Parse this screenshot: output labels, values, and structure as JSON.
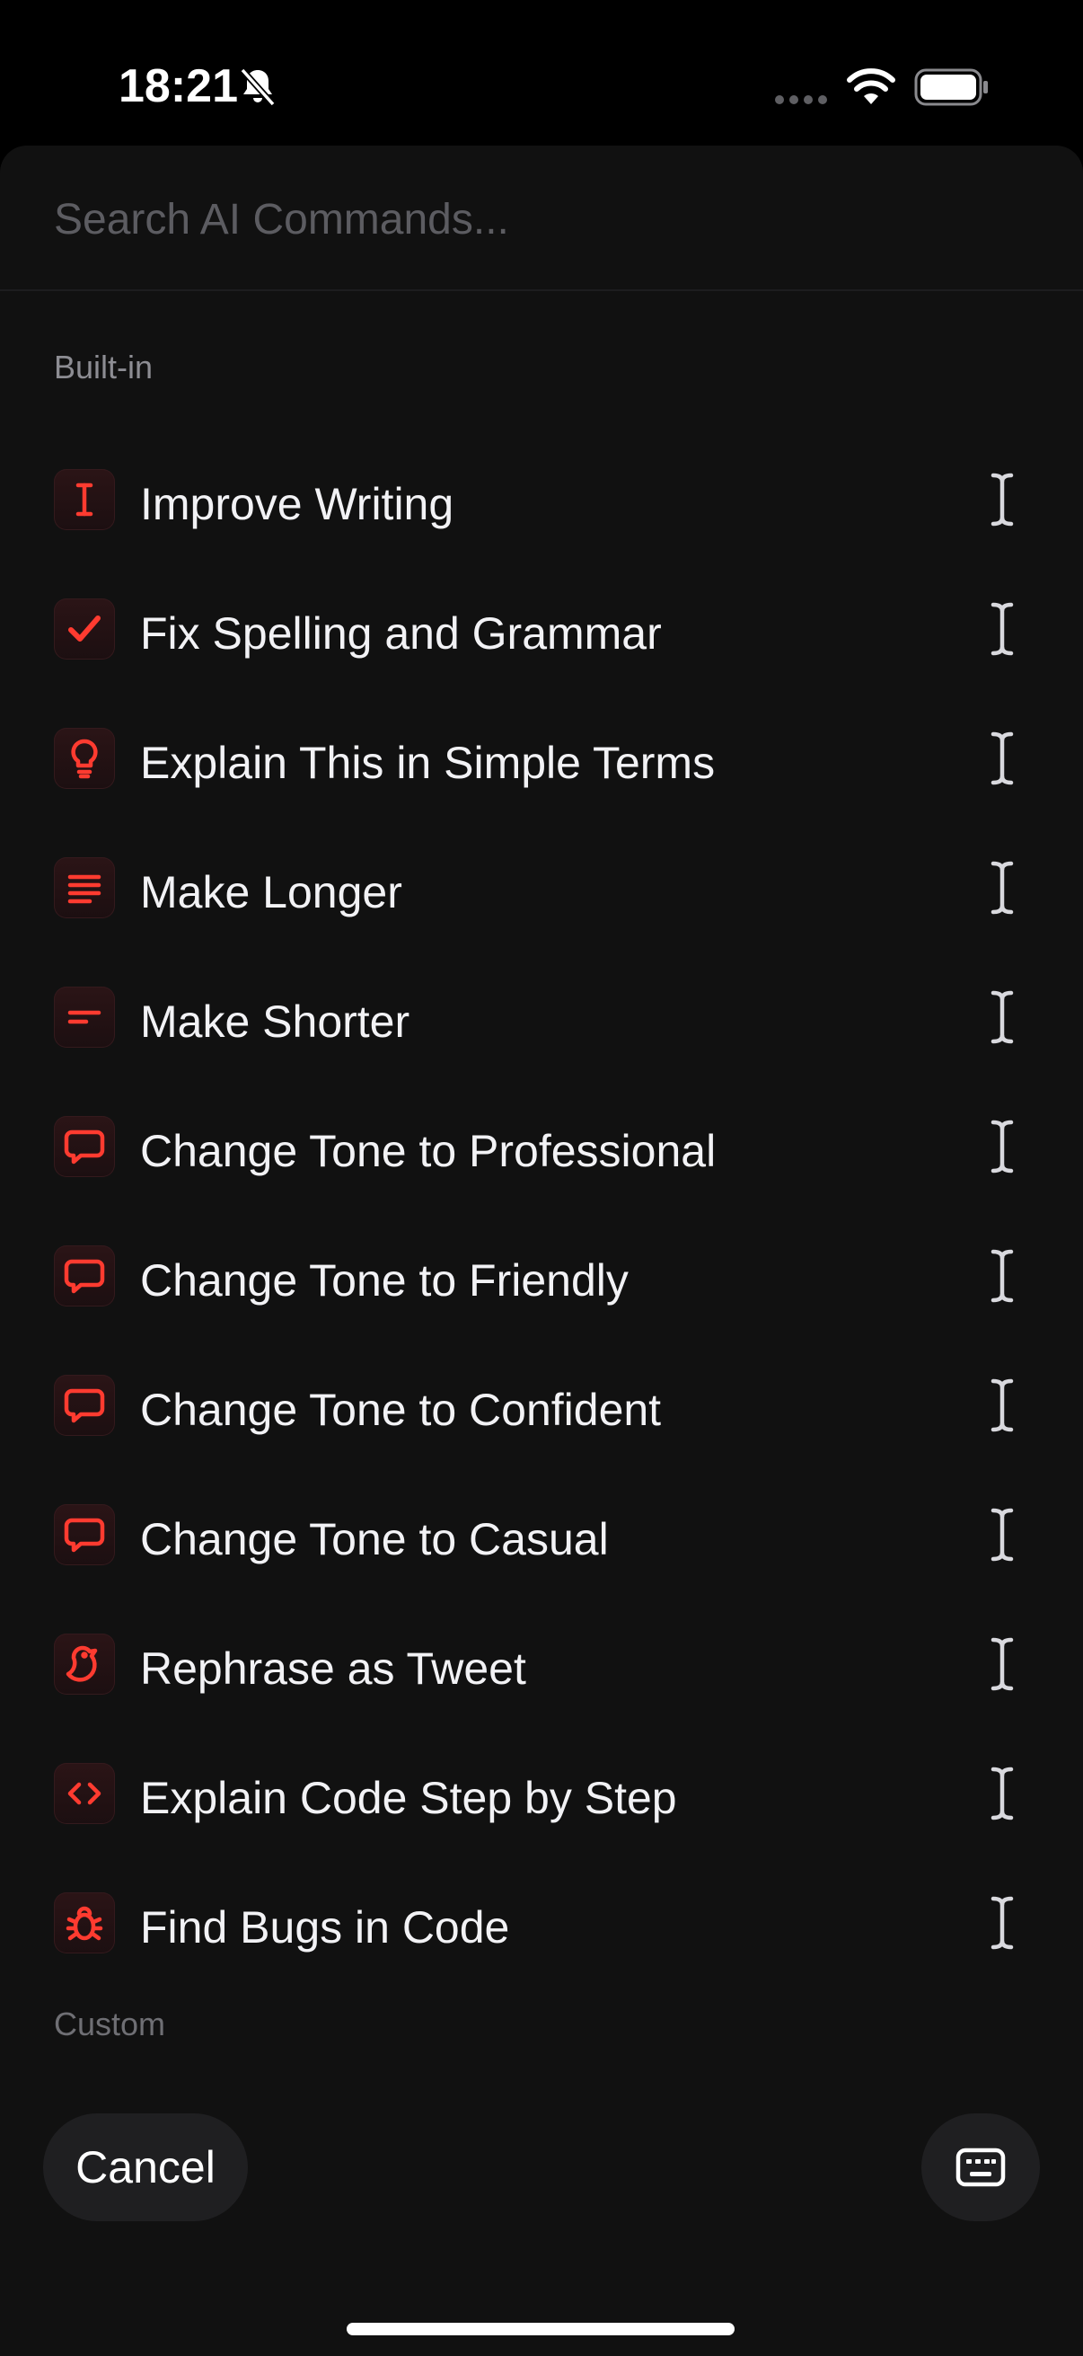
{
  "status_bar": {
    "time": "18:21",
    "icons": [
      "bell-slash-icon",
      "signal-icon",
      "wifi-icon",
      "battery-icon"
    ]
  },
  "search": {
    "placeholder": "Search AI Commands...",
    "value": ""
  },
  "sections": {
    "builtin_label": "Built-in",
    "custom_label": "Custom"
  },
  "commands": [
    {
      "label": "Improve Writing",
      "icon": "text-cursor-icon"
    },
    {
      "label": "Fix Spelling and Grammar",
      "icon": "checkmark-icon"
    },
    {
      "label": "Explain This in Simple Terms",
      "icon": "lightbulb-icon"
    },
    {
      "label": "Make Longer",
      "icon": "lines-long-icon"
    },
    {
      "label": "Make Shorter",
      "icon": "lines-short-icon"
    },
    {
      "label": "Change Tone to Professional",
      "icon": "speech-bubble-icon"
    },
    {
      "label": "Change Tone to Friendly",
      "icon": "speech-bubble-icon"
    },
    {
      "label": "Change Tone to Confident",
      "icon": "speech-bubble-icon"
    },
    {
      "label": "Change Tone to Casual",
      "icon": "speech-bubble-icon"
    },
    {
      "label": "Rephrase as Tweet",
      "icon": "bird-icon"
    },
    {
      "label": "Explain Code Step by Step",
      "icon": "code-brackets-icon"
    },
    {
      "label": "Find Bugs in Code",
      "icon": "bug-icon"
    }
  ],
  "footer": {
    "cancel_label": "Cancel",
    "keyboard_icon": "keyboard-icon"
  },
  "colors": {
    "accent": "#ff3b30",
    "sheet_background": "#111111",
    "button_background": "#1f1f21",
    "placeholder": "#5c5c61",
    "section_label": "#8d8d93"
  }
}
